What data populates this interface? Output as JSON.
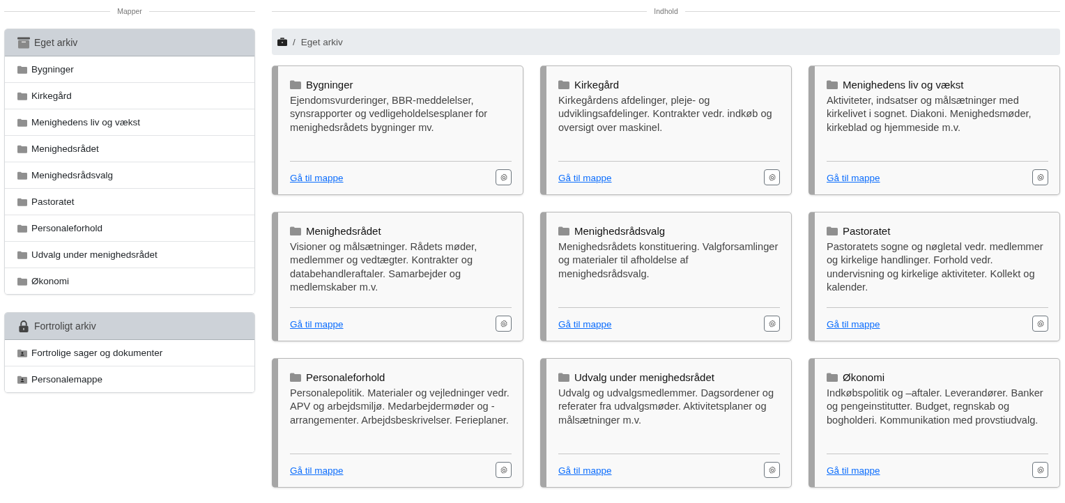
{
  "sidebar": {
    "heading": "Mapper",
    "panels": [
      {
        "title": "Eget arkiv",
        "kind": "archive",
        "items": [
          {
            "label": "Bygninger",
            "kind": "folder"
          },
          {
            "label": "Kirkegård",
            "kind": "folder"
          },
          {
            "label": "Menighedens liv og vækst",
            "kind": "folder"
          },
          {
            "label": "Menighedsrådet",
            "kind": "folder"
          },
          {
            "label": "Menighedsrådsvalg",
            "kind": "folder"
          },
          {
            "label": "Pastoratet",
            "kind": "folder"
          },
          {
            "label": "Personaleforhold",
            "kind": "folder"
          },
          {
            "label": "Udvalg under menighedsrådet",
            "kind": "folder"
          },
          {
            "label": "Økonomi",
            "kind": "folder"
          }
        ]
      },
      {
        "title": "Fortroligt arkiv",
        "kind": "lock",
        "items": [
          {
            "label": "Fortrolige sager og dokumenter",
            "kind": "person-folder"
          },
          {
            "label": "Personalemappe",
            "kind": "person-folder"
          }
        ]
      }
    ]
  },
  "content": {
    "heading": "Indhold",
    "breadcrumb": {
      "separator": "/",
      "current": "Eget arkiv"
    },
    "cards": [
      {
        "title": "Bygninger",
        "description": "Ejendomsvurderinger, BBR-meddelelser, synsrapporter og vedligeholdelsesplaner for menighedsrådets bygninger mv.",
        "link": "Gå til mappe"
      },
      {
        "title": "Kirkegård",
        "description": "Kirkegårdens afdelinger, pleje- og udviklingsafdelinger. Kontrakter vedr. indkøb og oversigt over maskinel.",
        "link": "Gå til mappe"
      },
      {
        "title": "Menighedens liv og vækst",
        "description": "Aktiviteter, indsatser og målsætninger med kirkelivet i sognet. Diakoni. Menighedsmøder, kirkeblad og hjemmeside m.v.",
        "link": "Gå til mappe"
      },
      {
        "title": "Menighedsrådet",
        "description": "Visioner og målsætninger. Rådets møder, medlemmer og vedtægter. Kontrakter og databehandleraftaler. Samarbejder og medlemskaber m.v.",
        "link": "Gå til mappe"
      },
      {
        "title": "Menighedsrådsvalg",
        "description": "Menighedsrådets konstituering. Valgforsamlinger og materialer til afholdelse af menighedsrådsvalg.",
        "link": "Gå til mappe"
      },
      {
        "title": "Pastoratet",
        "description": "Pastoratets sogne og nøgletal vedr. medlemmer og kirkelige handlinger. Forhold vedr. undervisning og kirkelige aktiviteter. Kollekt og kalender.",
        "link": "Gå til mappe"
      },
      {
        "title": "Personaleforhold",
        "description": "Personalepolitik. Materialer og vejledninger vedr. APV og arbejdsmiljø. Medarbejdermøder og -arrangementer. Arbejdsbeskrivelser. Ferieplaner.",
        "link": "Gå til mappe"
      },
      {
        "title": "Udvalg under menighedsrådet",
        "description": "Udvalg og udvalgsmedlemmer. Dagsordener og referater fra udvalgsmøder. Aktivitetsplaner og målsætninger m.v.",
        "link": "Gå til mappe"
      },
      {
        "title": "Økonomi",
        "description": "Indkøbspolitik og –aftaler. Leverandører. Banker og pengeinstitutter. Budget, regnskab og bogholderi. Kommunikation med provstiudvalg.",
        "link": "Gå til mappe"
      }
    ]
  }
}
